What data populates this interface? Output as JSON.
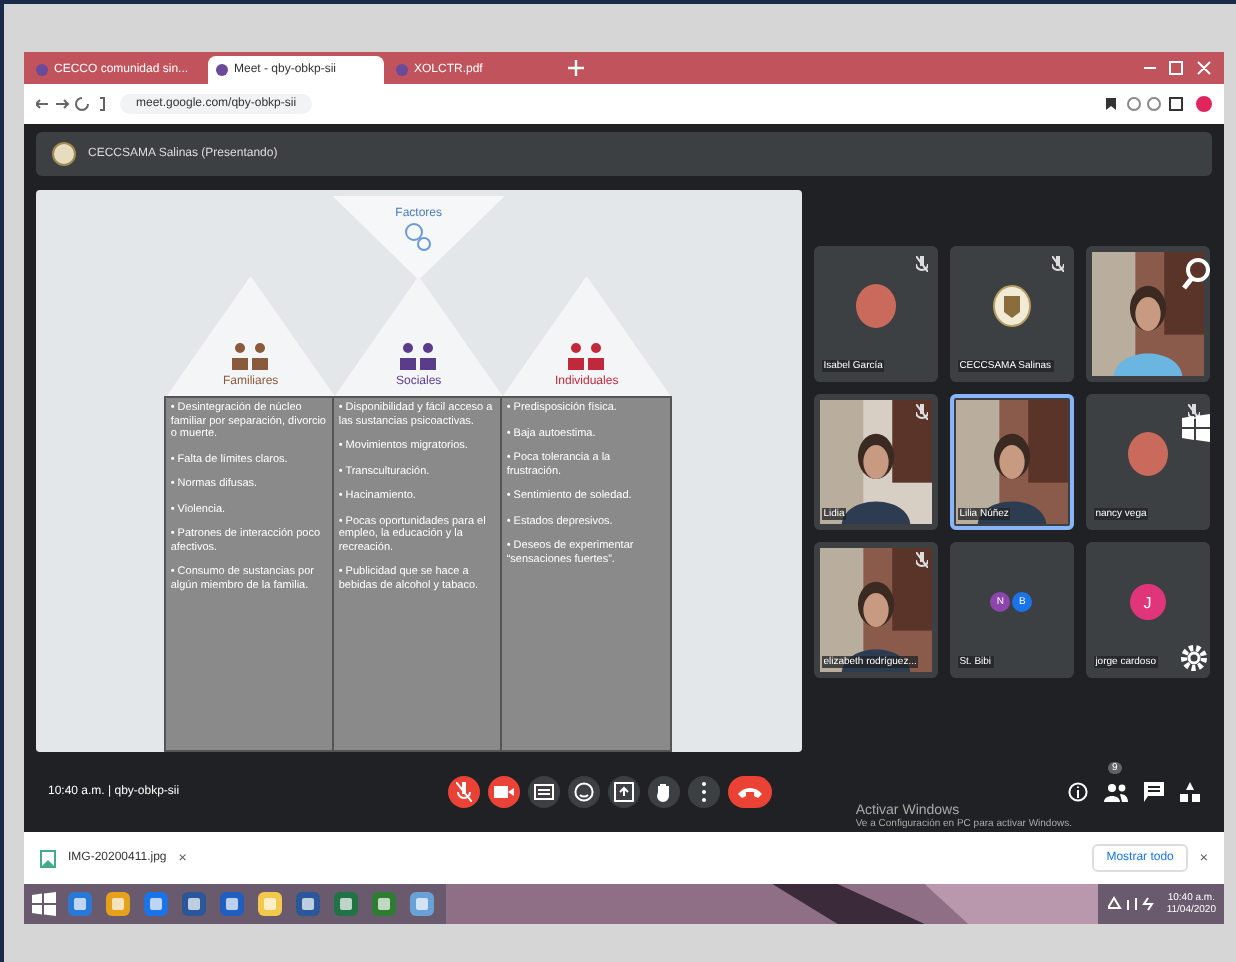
{
  "browser": {
    "tabs": [
      {
        "title": "CECCO comunidad sin...",
        "selected": false
      },
      {
        "title": "Meet - qby-obkp-sii",
        "selected": true
      },
      {
        "title": "XOLCTR.pdf",
        "selected": false
      }
    ],
    "url": "meet.google.com/qby-obkp-sii"
  },
  "meet": {
    "presenter": "CECCSAMA Salinas (Presentando)",
    "slide": {
      "title": "Factores",
      "columns": [
        {
          "heading": "Familiares",
          "color": "#8a5a3c",
          "items": [
            "• Desintegración de núcleo familiar por separación, divorcio o muerte.",
            "• Falta de límites claros.",
            "• Normas difusas.",
            "• Violencia.",
            "• Patrones de interacción poco afectivos.",
            "• Consumo de sustancias por algún miembro de la familia."
          ]
        },
        {
          "heading": "Sociales",
          "color": "#5a3c8a",
          "items": [
            "• Disponibilidad y fácil acceso a las sustancias psicoactivas.",
            "• Movimientos migratorios.",
            "• Transculturación.",
            "• Hacinamiento.",
            "• Pocas oportunidades para el empleo, la educación y la recreación.",
            "• Publicidad que se hace a bebidas de alcohol y tabaco."
          ]
        },
        {
          "heading": "Individuales",
          "color": "#c0283c",
          "items": [
            "• Predisposición física.",
            "• Baja autoestima.",
            "• Poca tolerancia a la frustración.",
            "• Sentimiento de soledad.",
            "• Estados depresivos.",
            "• Deseos de experimentar “sensaciones fuertes”."
          ]
        }
      ]
    },
    "tiles": [
      {
        "name": "Isabel García",
        "kind": "avatar",
        "muted": true,
        "speaking": false
      },
      {
        "name": "CECCSAMA Salinas",
        "kind": "logo",
        "muted": true,
        "speaking": false
      },
      {
        "kind": "video",
        "muted": false,
        "speaking": false
      },
      {
        "name": "Lidia",
        "kind": "video",
        "muted": true,
        "speaking": false
      },
      {
        "name": "Lilia Núñez",
        "kind": "video",
        "muted": false,
        "speaking": true
      },
      {
        "name": "nancy vega",
        "kind": "avatar",
        "muted": true,
        "speaking": false
      },
      {
        "name": "elizabeth rodríguez...",
        "kind": "video",
        "muted": true,
        "speaking": false
      },
      {
        "name": "St. Bibi",
        "kind": "initials",
        "initials": [
          "N",
          "B"
        ],
        "muted": false,
        "speaking": false
      },
      {
        "name": "jorge cardoso",
        "kind": "initials",
        "initials": [
          "J"
        ],
        "muted": false,
        "speaking": false
      }
    ],
    "meeting_info": "10:40 a.m. | qby-obkp-sii",
    "participants_badge": "9"
  },
  "activation": {
    "title": "Activar Windows",
    "subtitle": "Ve a Configuración en PC para activar Windows."
  },
  "download": {
    "file": "IMG-20200411.jpg",
    "close": "×",
    "show_all": "Mostrar todo",
    "dismiss": "×"
  },
  "taskbar": {
    "time": "10:40 a.m.",
    "date": "11/04/2020"
  }
}
